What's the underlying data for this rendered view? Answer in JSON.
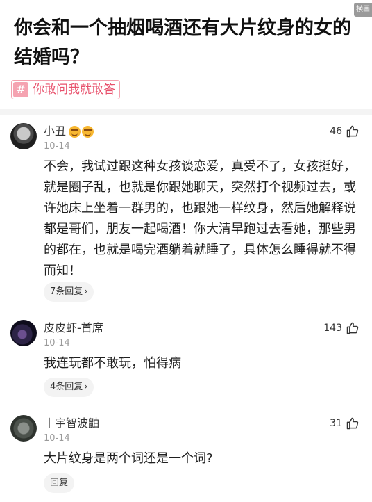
{
  "corner_badge": "横画",
  "question": {
    "title": "你会和一个抽烟喝酒还有大片纹身的女的结婚吗？"
  },
  "topic": {
    "hash_icon": "#",
    "label": "你敢问我就敢答"
  },
  "comments": [
    {
      "avatar_icon": "avatar",
      "user": "小丑",
      "emoji_count": 2,
      "date": "10-14",
      "likes": "46",
      "body": "不会，我试过跟这种女孩谈恋爱，真受不了，女孩挺好，就是圈子乱，也就是你跟她聊天，突然打个视频过去，或许她床上坐着一群男的，也跟她一样纹身，然后她解释说都是哥们，朋友一起喝酒！你大清早跑过去看她，那些男的都在，也就是喝完酒躺着就睡了，具体怎么睡得就不得而知！",
      "reply_label": "7条回复",
      "reply_chevron": "›"
    },
    {
      "avatar_icon": "avatar",
      "user": "皮皮虾-首席",
      "date": "10-14",
      "likes": "143",
      "body": "我连玩都不敢玩，怕得病",
      "reply_label": "4条回复",
      "reply_chevron": "›"
    },
    {
      "avatar_icon": "avatar",
      "user": "丨宇智波鼬",
      "date": "10-14",
      "likes": "31",
      "body": "大片纹身是两个词还是一个词?",
      "reply_label": "回复"
    }
  ],
  "colors": {
    "tag_pink": "#e8516c",
    "tag_border": "#f3a0ad",
    "muted": "#9a9a9a"
  }
}
